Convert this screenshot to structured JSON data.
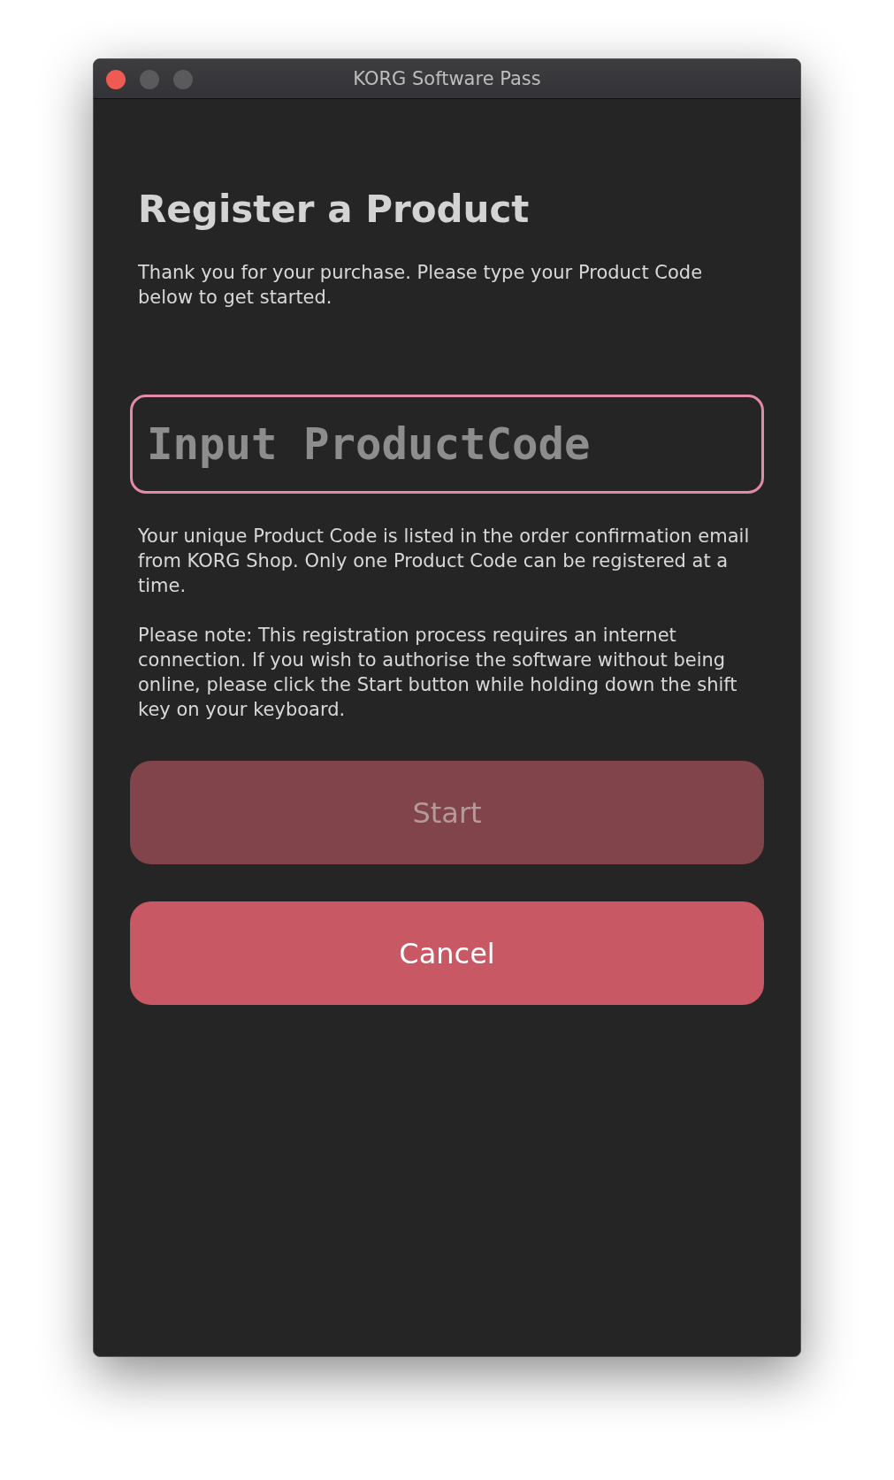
{
  "window": {
    "title": "KORG Software Pass"
  },
  "heading": "Register a Product",
  "intro": "Thank you for your purchase. Please type your Product Code below to get started.",
  "product_code_field": {
    "placeholder": "Input ProductCode",
    "focused": true
  },
  "notes": [
    "Your unique Product Code is listed in the order confirmation email from KORG Shop. Only one Product Code can be registered at a time.",
    "Please note: This registration process requires an internet connection. If you wish to authorise the software without being online, please click the Start button while holding down the shift key on your keyboard."
  ],
  "buttons": [
    {
      "label": "Start",
      "disabled": true
    },
    {
      "label": "Cancel",
      "disabled": false
    }
  ]
}
